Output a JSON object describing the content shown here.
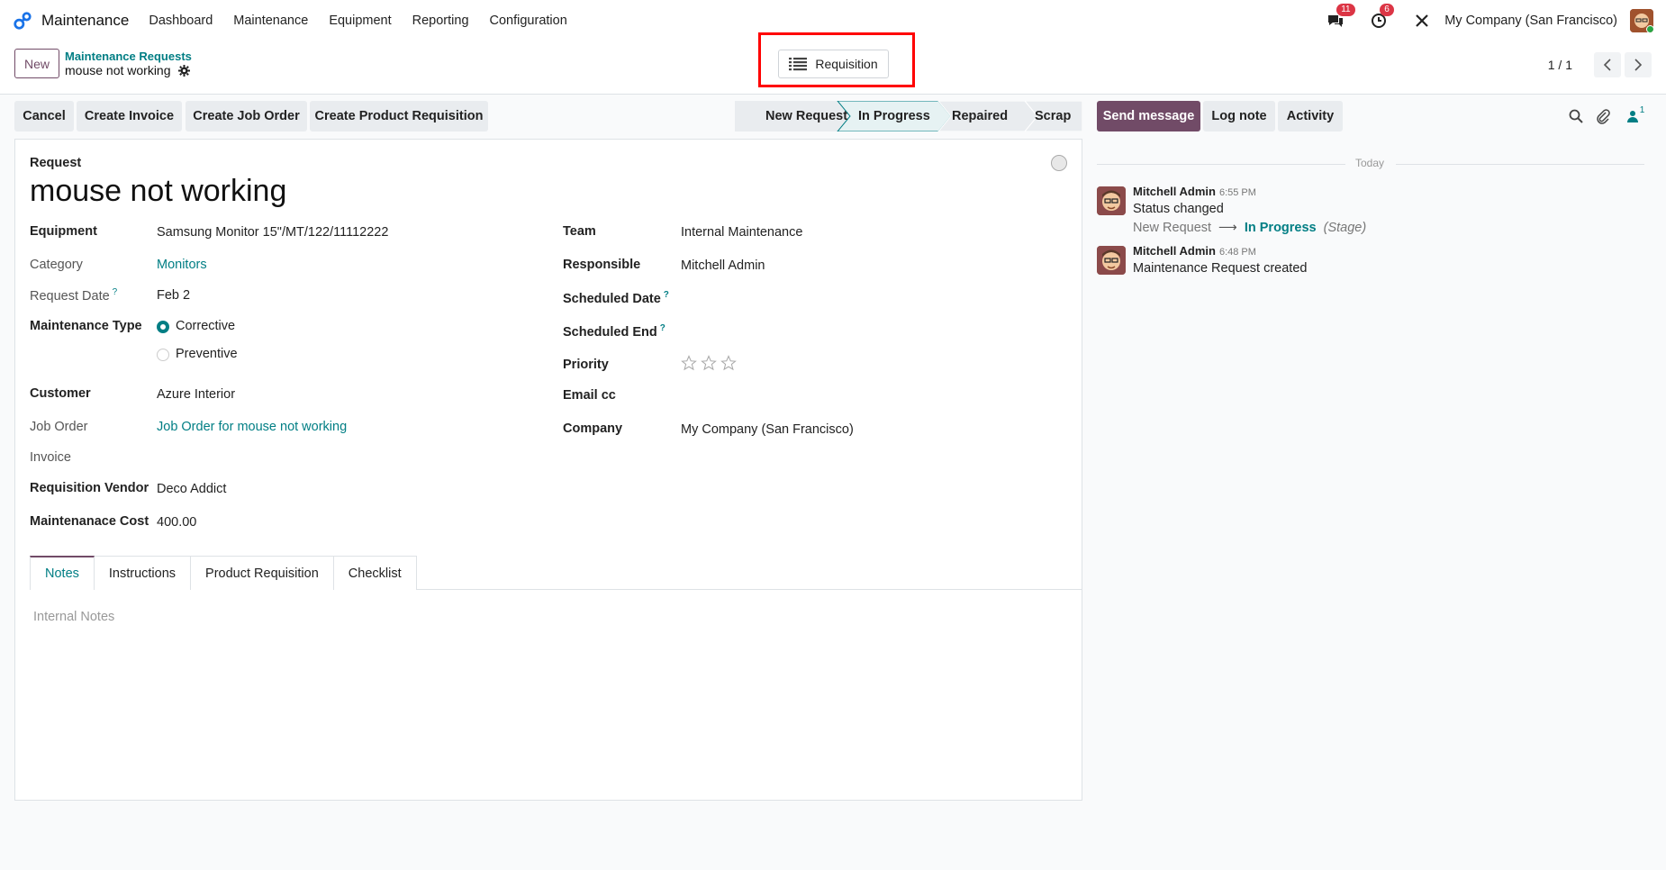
{
  "navbar": {
    "app_name": "Maintenance",
    "menu": [
      "Dashboard",
      "Maintenance",
      "Equipment",
      "Reporting",
      "Configuration"
    ],
    "messages_count": "11",
    "activities_count": "6",
    "company": "My Company (San Francisco)"
  },
  "control": {
    "new_label": "New",
    "breadcrumb": "Maintenance Requests",
    "record_name": "mouse not working",
    "smart_button": "Requisition",
    "pager": "1 / 1"
  },
  "statusbar": {
    "buttons": [
      "Cancel",
      "Create Invoice",
      "Create Job Order",
      "Create Product Requisition"
    ],
    "stages": [
      "New Request",
      "In Progress",
      "Repaired",
      "Scrap"
    ],
    "active_stage": "In Progress"
  },
  "form": {
    "request_label": "Request",
    "title": "mouse not working",
    "left": {
      "equipment_label": "Equipment",
      "equipment": "Samsung Monitor 15\"/MT/122/11112222",
      "category_label": "Category",
      "category": "Monitors",
      "request_date_label": "Request Date",
      "request_date": "Feb 2",
      "maintenance_type_label": "Maintenance Type",
      "type_options": [
        "Corrective",
        "Preventive"
      ],
      "customer_label": "Customer",
      "customer": "Azure Interior",
      "job_order_label": "Job Order",
      "job_order": "Job Order for mouse not working",
      "invoice_label": "Invoice",
      "vendor_label": "Requisition Vendor",
      "vendor": "Deco Addict",
      "cost_label": "Maintenanace Cost",
      "cost": "400.00"
    },
    "right": {
      "team_label": "Team",
      "team": "Internal Maintenance",
      "responsible_label": "Responsible",
      "responsible": "Mitchell Admin",
      "scheduled_date_label": "Scheduled Date",
      "scheduled_end_label": "Scheduled End",
      "priority_label": "Priority",
      "priority_stars": 0,
      "email_cc_label": "Email cc",
      "company_label": "Company",
      "company": "My Company (San Francisco)"
    },
    "help_mark": "?",
    "tabs": [
      "Notes",
      "Instructions",
      "Product Requisition",
      "Checklist"
    ],
    "notes_placeholder": "Internal Notes"
  },
  "chatter": {
    "send_message": "Send message",
    "log_note": "Log note",
    "activity": "Activity",
    "followers_count": "1",
    "today": "Today",
    "messages": [
      {
        "author": "Mitchell Admin",
        "time": "6:55 PM",
        "text": "Status changed",
        "from": "New Request",
        "to": "In Progress",
        "field": "(Stage)"
      },
      {
        "author": "Mitchell Admin",
        "time": "6:48 PM",
        "text": "Maintenance Request created"
      }
    ]
  },
  "colors": {
    "brand": "#714b67",
    "link": "#017e84",
    "highlight": "#ff0000"
  }
}
